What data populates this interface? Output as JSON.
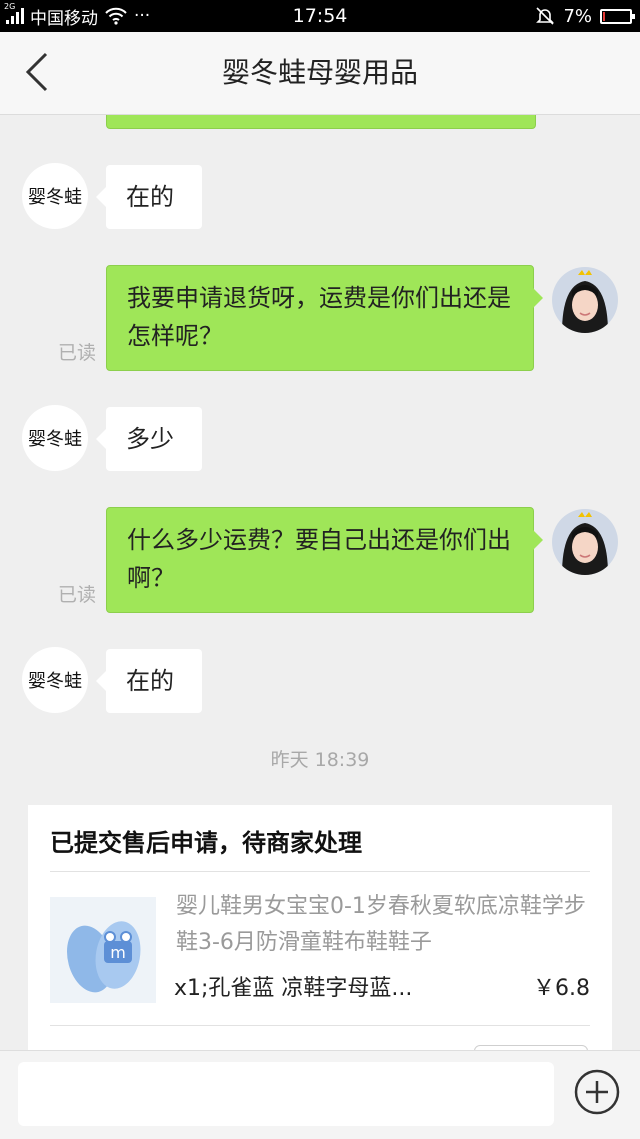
{
  "status_bar": {
    "network": "2G",
    "carrier": "中国移动",
    "more": "···",
    "time": "17:54",
    "battery": "7%",
    "battery_level": 0.07,
    "battery_color": "#e53935"
  },
  "header": {
    "title": "婴冬蛙母婴用品"
  },
  "chat": {
    "shop_avatar_text": "婴冬蛙",
    "read_label": "已读",
    "messages": [
      {
        "from": "shop",
        "text": "在的"
      },
      {
        "from": "me",
        "text": "我要申请退货呀，运费是你们出还是怎样呢？"
      },
      {
        "from": "shop",
        "text": "多少"
      },
      {
        "from": "me",
        "text": "什么多少运费？要自己出还是你们出啊？"
      },
      {
        "from": "shop",
        "text": "在的"
      }
    ],
    "timestamp": "昨天 18:39"
  },
  "order_card": {
    "title": "已提交售后申请，待商家处理",
    "product_name": "婴儿鞋男女宝宝0-1岁春秋夏软底凉鞋学步鞋3-6月防滑童鞋布鞋鞋子",
    "spec": "x1;孔雀蓝 凉鞋字母蓝...",
    "price": "￥6.8"
  },
  "input_bar": {
    "placeholder": ""
  },
  "icons": [
    "back-icon",
    "wifi-icon",
    "mute-bell-icon",
    "battery-icon",
    "plus-circle-icon"
  ],
  "colors": {
    "bubble_out": "#9fe658",
    "background": "#efefef"
  }
}
